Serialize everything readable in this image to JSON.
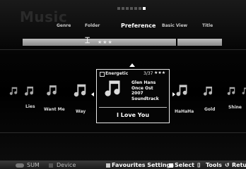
{
  "app": {
    "title": "Music"
  },
  "nav": {
    "tabs": [
      {
        "label": "Genre"
      },
      {
        "label": "Folder"
      },
      {
        "label": "Preference"
      },
      {
        "label": "Basic View"
      },
      {
        "label": "Title"
      }
    ],
    "active_tab": "Preference",
    "page_dots": {
      "total": 7,
      "active_index": 6
    }
  },
  "scrubber": {
    "stars": "★★★"
  },
  "items": [
    {
      "label": ""
    },
    {
      "label": "Lies"
    },
    {
      "label": "Want Me"
    },
    {
      "label": "Way"
    },
    {
      "label": "HaHaHa"
    },
    {
      "label": "Gold"
    },
    {
      "label": "Shine"
    }
  ],
  "selected": {
    "category": "Energetic",
    "count": "3/37",
    "stars": "★★★",
    "artist": "Glen Hans",
    "album": "Once Ost",
    "year": "2007",
    "genre": "Soundtrack",
    "title": "I Love You"
  },
  "bottom": {
    "sum_label": "SUM",
    "device_label": "Device",
    "favourites_label": "Favourites Settings",
    "select_label": "Select",
    "tools_label": "Tools",
    "return_label": "Retu"
  },
  "colors": {
    "red_button": "#d42b2b",
    "green_button": "#32a84a",
    "yellow_button": "#d8c23a",
    "blue_button": "#3a63c9",
    "favourites_button": "#c8c8c8"
  }
}
